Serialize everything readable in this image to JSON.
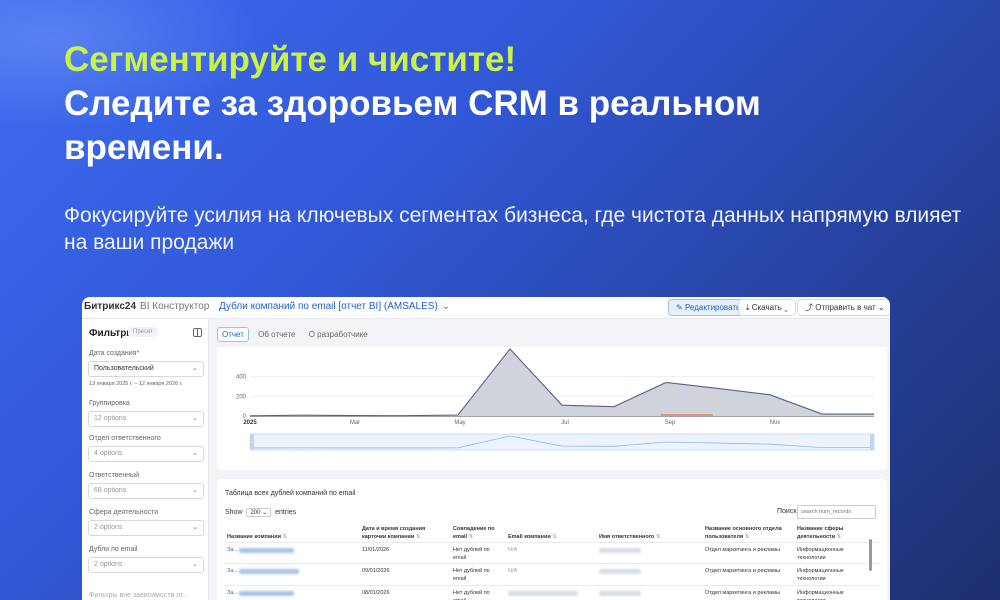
{
  "promo": {
    "title_accent": "Сегментируйте и чистите!",
    "title_main": "Следите за здоровьем CRM в реальном времени.",
    "subtitle": "Фокусируйте усилия на ключевых сегментах бизнеса, где чистота данных напрямую влияет на ваши продажи"
  },
  "topbar": {
    "brand": "Битрикс24",
    "brand_suffix": "BI Конструктор",
    "report_title": "Дубли компаний по email [отчет BI] (AMSALES)",
    "edit_label": "Редактировать",
    "download_label": "Скачать",
    "send_label": "Отправить в чат"
  },
  "sidebar": {
    "title": "Фильтры",
    "preset": "Пресет",
    "filters": [
      {
        "label": "Дата создания*",
        "value": "Пользовательский",
        "note": "13 января 2025 г. – 12 января 2026 г."
      },
      {
        "label": "Группировка",
        "value": "12 options"
      },
      {
        "label": "Отдел ответственного",
        "value": "4 options"
      },
      {
        "label": "Ответственный",
        "value": "68 options"
      },
      {
        "label": "Сфера деятельности",
        "value": "2 options"
      },
      {
        "label": "Дубли по email",
        "value": "2 options"
      }
    ],
    "footer": "Фильтры вне зависимости от..."
  },
  "tabs": [
    {
      "label": "Отчет",
      "active": true
    },
    {
      "label": "Об отчете",
      "active": false
    },
    {
      "label": "О разработчике",
      "active": false
    }
  ],
  "chart_data": {
    "type": "area",
    "x_ticks": [
      "2025",
      "Mar",
      "May",
      "Jul",
      "Sep",
      "Nov"
    ],
    "y_ticks": [
      0,
      200,
      400
    ],
    "ylim": [
      0,
      680
    ],
    "x": [
      0,
      1,
      2,
      3,
      4,
      5,
      6,
      7,
      8,
      9,
      10,
      11,
      12
    ],
    "values": [
      2,
      8,
      4,
      3,
      10,
      680,
      110,
      95,
      340,
      280,
      215,
      20,
      20
    ],
    "colors": {
      "fill": "#c9cbd6",
      "line": "#5a6088",
      "marker": "#e8743b"
    }
  },
  "table": {
    "title": "Таблица всех дублей компаний по email",
    "show_label": "Show",
    "show_value": "200",
    "entries_label": "entries",
    "search_label": "Поиск",
    "search_placeholder": "search num_records",
    "columns": [
      "Название компании",
      "Дата и время создания карточки компании",
      "Совпадение по email",
      "Email компании",
      "Имя ответственного",
      "Название основного отдела пользователя",
      "Название сферы деятельности"
    ],
    "rows": [
      {
        "company": "За...",
        "created": "11/01/2026",
        "match": "Нет дублей по email",
        "email": "N/A",
        "dept": "Отдел маркетинга и рекламы",
        "sphere": "Информационные технологии"
      },
      {
        "company": "За...",
        "created": "09/01/2026",
        "match": "Нет дублей по email",
        "email": "N/A",
        "dept": "Отдел маркетинга и рекламы",
        "sphere": "Информационные технологии"
      },
      {
        "company": "За...",
        "created": "08/01/2026",
        "match": "Нет дублей по email",
        "email": "",
        "dept": "Отдел маркетинга и рекламы",
        "sphere": "Информационные технологии"
      }
    ]
  }
}
